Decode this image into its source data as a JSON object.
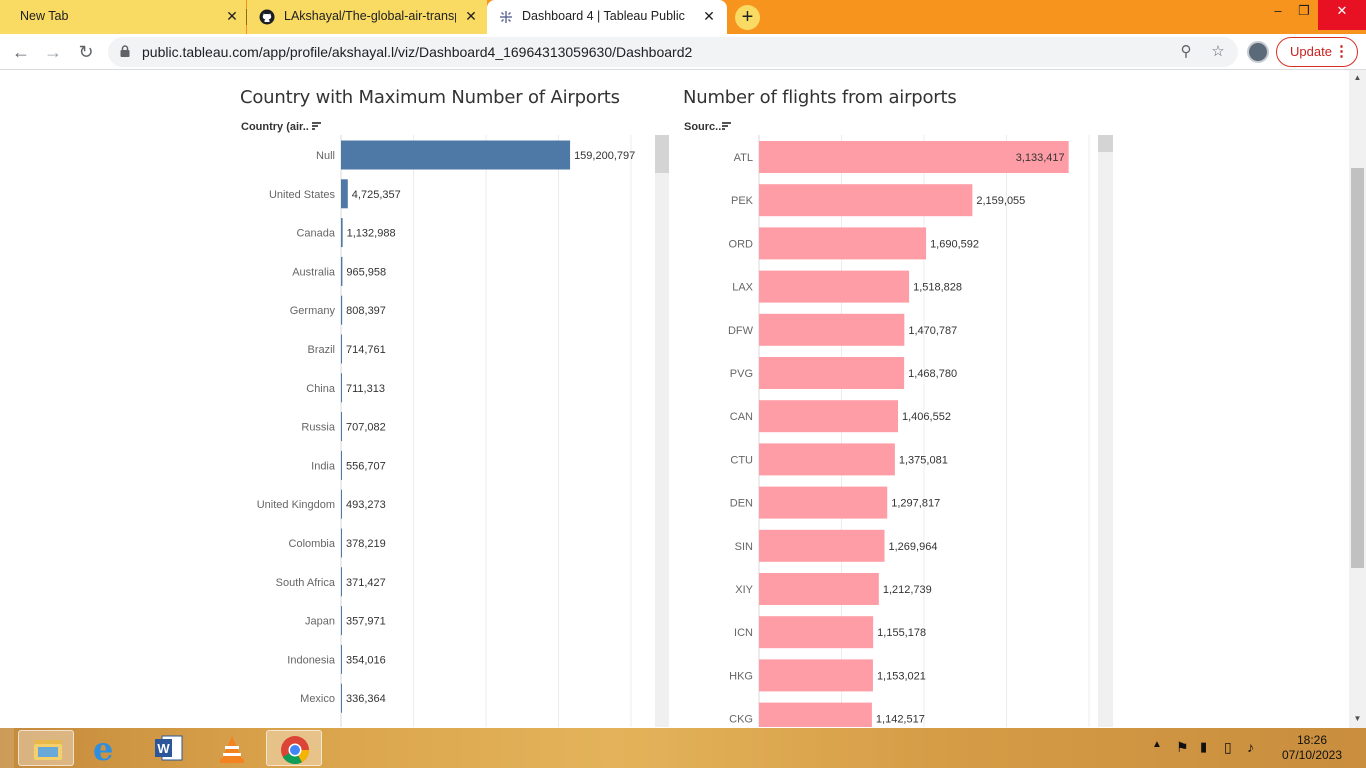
{
  "browser": {
    "tabs": [
      {
        "title": "New Tab",
        "active": false
      },
      {
        "title": "LAkshayal/The-global-air-transpo",
        "active": false
      },
      {
        "title": "Dashboard 4 | Tableau Public",
        "active": true
      }
    ],
    "url": "public.tableau.com/app/profile/akshayal.l/viz/Dashboard4_16964313059630/Dashboard2",
    "update_label": "Update",
    "colors": {
      "tabstrip": "#f7941e",
      "inactive_tab": "#f9da63"
    }
  },
  "left_chart": {
    "title": "Country with Maximum Number of Airports",
    "field_header": "Country (air..",
    "bar_color": "#4e79a7"
  },
  "right_chart": {
    "title": "Number of flights from airports",
    "field_header": "Sourc..",
    "bar_color": "#ff9da7"
  },
  "chart_data": [
    {
      "type": "bar",
      "orientation": "horizontal",
      "title": "Country with Maximum Number of Airports",
      "ylabel": "Country (air..",
      "categories": [
        "Null",
        "United States",
        "Canada",
        "Australia",
        "Germany",
        "Brazil",
        "China",
        "Russia",
        "India",
        "United Kingdom",
        "Colombia",
        "South Africa",
        "Japan",
        "Indonesia",
        "Mexico"
      ],
      "values": [
        159200797,
        4725357,
        1132988,
        965958,
        808397,
        714761,
        711313,
        707082,
        556707,
        493273,
        378219,
        371427,
        357971,
        354016,
        336364
      ],
      "labels": [
        "159,200,797",
        "4,725,357",
        "1,132,988",
        "965,958",
        "808,397",
        "714,761",
        "711,313",
        "707,082",
        "556,707",
        "493,273",
        "378,219",
        "371,427",
        "357,971",
        "354,016",
        "336,364"
      ],
      "xlim": [
        0,
        180000000
      ],
      "grid": true,
      "color": "#4e79a7"
    },
    {
      "type": "bar",
      "orientation": "horizontal",
      "title": "Number of flights from airports",
      "ylabel": "Sourc..",
      "categories": [
        "ATL",
        "PEK",
        "ORD",
        "LAX",
        "DFW",
        "PVG",
        "CAN",
        "CTU",
        "DEN",
        "SIN",
        "XIY",
        "ICN",
        "HKG",
        "CKG"
      ],
      "values": [
        3133417,
        2159055,
        1690592,
        1518828,
        1470787,
        1468780,
        1406552,
        1375081,
        1297817,
        1269964,
        1212739,
        1155178,
        1153021,
        1142517
      ],
      "labels": [
        "3,133,417",
        "2,159,055",
        "1,690,592",
        "1,518,828",
        "1,470,787",
        "1,468,780",
        "1,406,552",
        "1,375,081",
        "1,297,817",
        "1,269,964",
        "1,212,739",
        "1,155,178",
        "1,153,021",
        "1,142,517"
      ],
      "xlim": [
        0,
        3400000
      ],
      "grid": true,
      "color": "#ff9da7"
    }
  ],
  "taskbar": {
    "apps": [
      "file-explorer",
      "internet-explorer",
      "word",
      "vlc",
      "chrome"
    ],
    "time": "18:26",
    "date": "07/10/2023"
  }
}
